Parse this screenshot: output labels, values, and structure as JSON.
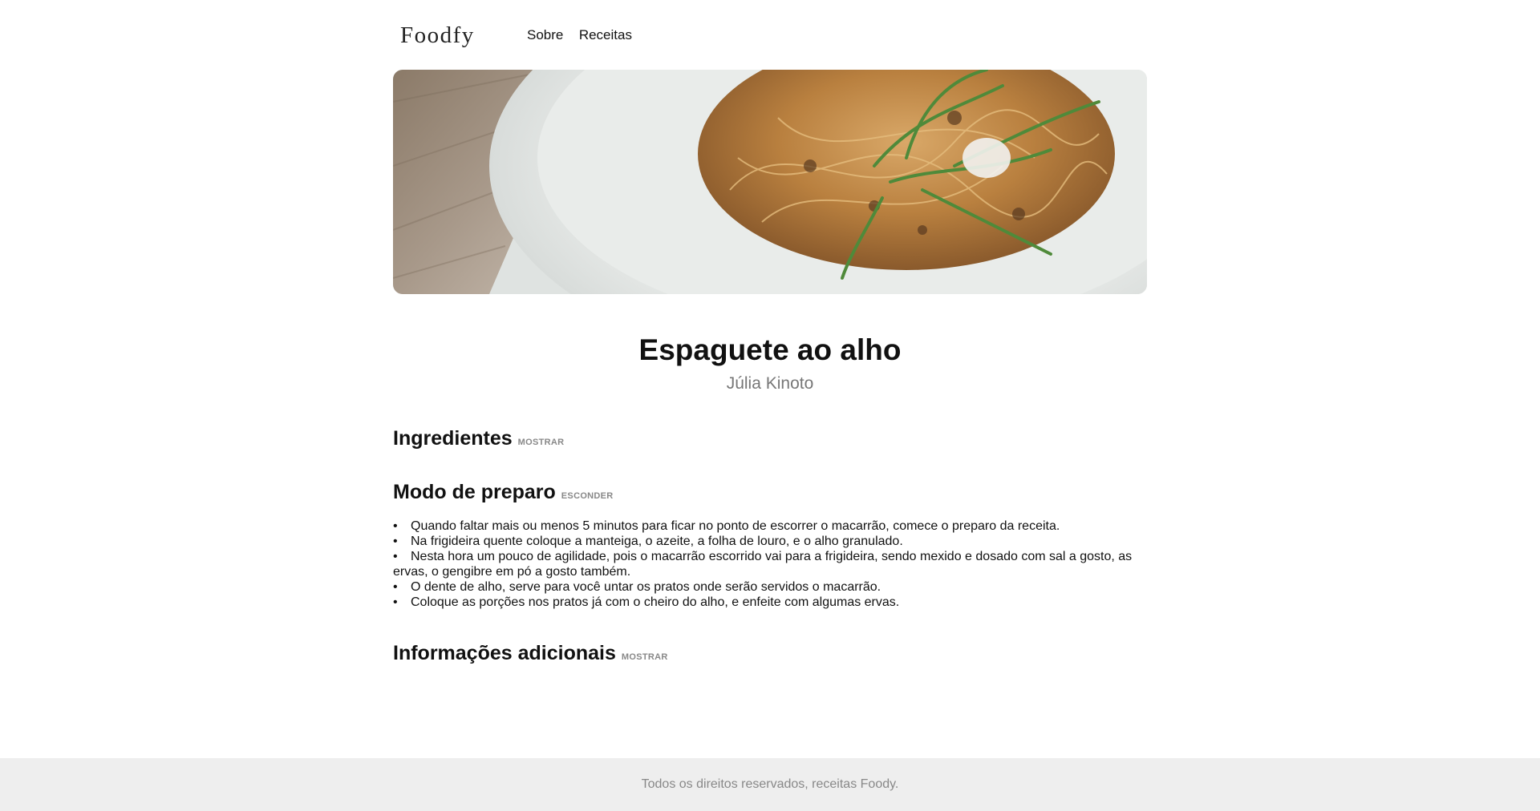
{
  "header": {
    "logo": "Foodfy",
    "nav": [
      {
        "label": "Sobre"
      },
      {
        "label": "Receitas"
      }
    ]
  },
  "recipe": {
    "title": "Espaguete ao alho",
    "author": "Júlia Kinoto"
  },
  "sections": {
    "ingredientes": {
      "title": "Ingredientes",
      "toggle": "MOSTRAR"
    },
    "preparo": {
      "title": "Modo de preparo",
      "toggle": "ESCONDER",
      "steps": [
        "Quando faltar mais ou menos 5 minutos para ficar no ponto de escorrer o macarrão, comece o preparo da receita.",
        "Na frigideira quente coloque a manteiga, o azeite, a folha de louro, e o alho granulado.",
        "Nesta hora um pouco de agilidade, pois o macarrão escorrido vai para a frigideira, sendo mexido e dosado com sal a gosto, as ervas, o gengibre em pó a gosto também.",
        "O dente de alho, serve para você untar os pratos onde serão servidos o macarrão.",
        "Coloque as porções nos pratos já com o cheiro do alho, e enfeite com algumas ervas."
      ]
    },
    "info": {
      "title": "Informações adicionais",
      "toggle": "MOSTRAR"
    }
  },
  "footer": {
    "text": "Todos os direitos reservados, receitas Foody."
  }
}
